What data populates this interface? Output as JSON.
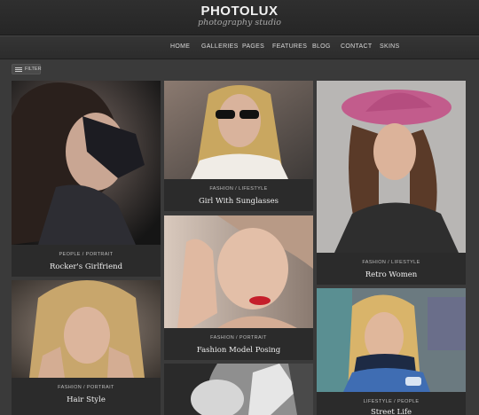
{
  "site": {
    "logo": "PHOTOLUX",
    "tagline": "photography studio"
  },
  "nav": [
    {
      "label": "HOME",
      "id": "home"
    },
    {
      "label": "GALLERIES",
      "id": "galleries"
    },
    {
      "label": "PAGES",
      "id": "pages"
    },
    {
      "label": "FEATURES",
      "id": "features"
    },
    {
      "label": "BLOG",
      "id": "blog"
    },
    {
      "label": "CONTACT",
      "id": "contact"
    },
    {
      "label": "SKINS",
      "id": "skins"
    }
  ],
  "filter": {
    "label": "FILTER",
    "icon": "menu-icon"
  },
  "gallery": [
    {
      "category": "PEOPLE / PORTRAIT",
      "title": "Rocker's Girlfriend"
    },
    {
      "category": "FASHION / LIFESTYLE",
      "title": "Girl With Sunglasses"
    },
    {
      "category": "FASHION / LIFESTYLE",
      "title": "Retro Women"
    },
    {
      "category": "FASHION / PORTRAIT",
      "title": "Fashion Model Posing"
    },
    {
      "category": "FASHION / PORTRAIT",
      "title": "Hair Style"
    },
    {
      "category": "LIFESTYLE / PEOPLE",
      "title": "Street Life"
    },
    {
      "category": "",
      "title": ""
    }
  ],
  "colors": {
    "background": "#3a3a3a",
    "caption": "#2b2b2b",
    "header": "#2a2a2a"
  }
}
